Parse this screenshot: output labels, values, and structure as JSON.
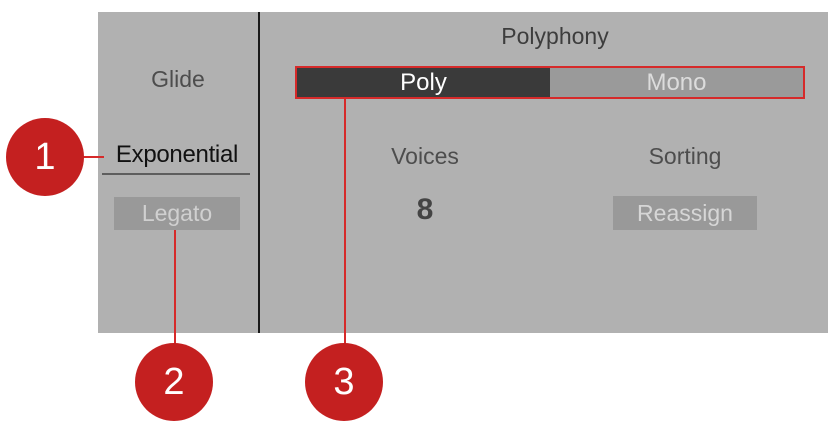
{
  "glide": {
    "label": "Glide",
    "mode": "Exponential",
    "legato_label": "Legato"
  },
  "polyphony": {
    "title": "Polyphony",
    "options": [
      "Poly",
      "Mono"
    ],
    "selected": "Poly",
    "voices_label": "Voices",
    "voices_value": "8",
    "sorting_label": "Sorting",
    "sorting_value": "Reassign"
  },
  "callouts": [
    "1",
    "2",
    "3"
  ],
  "colors": {
    "panel": "#b1b1b1",
    "selected_segment": "#3a3a3a",
    "unselected_segment": "#9a9a9a",
    "accent": "#c42020"
  }
}
